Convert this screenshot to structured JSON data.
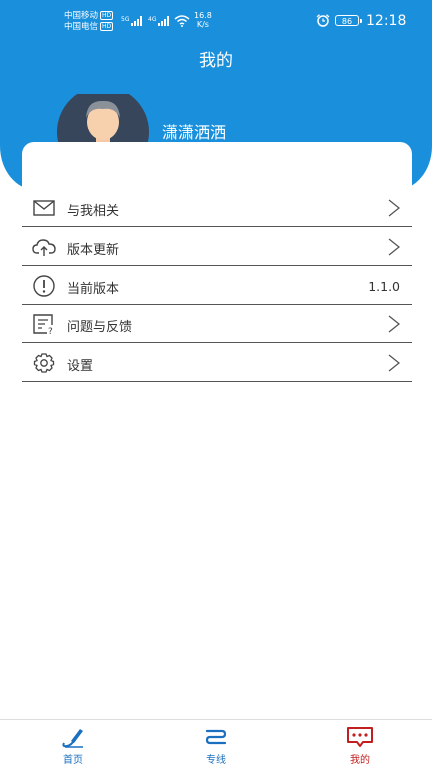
{
  "status_bar": {
    "carrier1": "中国移动",
    "carrier2": "中国电信",
    "hd": "HD",
    "net1": "5G",
    "net2": "4G",
    "speed_value": "16.8",
    "speed_unit": "K/s",
    "battery": "86",
    "time": "12:18"
  },
  "header": {
    "title": "我的",
    "username": "潇潇洒洒"
  },
  "menu": [
    {
      "label": "与我相关",
      "icon": "mail-icon",
      "trailing": "arrow"
    },
    {
      "label": "版本更新",
      "icon": "cloud-upload-icon",
      "trailing": "arrow"
    },
    {
      "label": "当前版本",
      "icon": "info-icon",
      "trailing": "value",
      "value": "1.1.0"
    },
    {
      "label": "问题与反馈",
      "icon": "feedback-icon",
      "trailing": "arrow"
    },
    {
      "label": "设置",
      "icon": "gear-icon",
      "trailing": "arrow"
    }
  ],
  "tabbar": {
    "home": "首页",
    "line": "专线",
    "mine": "我的"
  },
  "colors": {
    "brand_blue": "#1a90dc",
    "tab_blue": "#1a6fc0",
    "active_red": "#c22020"
  }
}
